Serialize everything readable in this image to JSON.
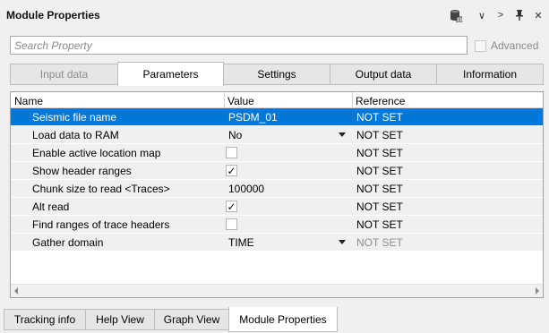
{
  "panel": {
    "title": "Module Properties",
    "toolbar": {
      "icons": [
        "database-icon",
        "chevron-down-icon",
        "chevron-right-icon",
        "pin-icon",
        "close-icon"
      ],
      "chevron_down": "∨",
      "chevron_right": ">",
      "close": "✕"
    }
  },
  "search": {
    "placeholder": "Search Property",
    "value": "",
    "advanced_label": "Advanced",
    "advanced_checked": false
  },
  "tabs": [
    {
      "label": "Input data",
      "state": "disabled"
    },
    {
      "label": "Parameters",
      "state": "active"
    },
    {
      "label": "Settings",
      "state": "normal"
    },
    {
      "label": "Output data",
      "state": "normal"
    },
    {
      "label": "Information",
      "state": "normal"
    }
  ],
  "grid": {
    "columns": [
      "Name",
      "Value",
      "Reference"
    ],
    "rows": [
      {
        "name": "Seismic file name",
        "value": "PSDM_01",
        "type": "text",
        "reference": "NOT SET",
        "selected": true
      },
      {
        "name": "Load data to RAM",
        "value": "No",
        "type": "dropdown",
        "reference": "NOT SET"
      },
      {
        "name": "Enable active location map",
        "value": "",
        "type": "checkbox",
        "checked": false,
        "reference": "NOT SET"
      },
      {
        "name": "Show header ranges",
        "value": "",
        "type": "checkbox",
        "checked": true,
        "reference": "NOT SET"
      },
      {
        "name": "Chunk size to read <Traces>",
        "value": "100000",
        "type": "text",
        "reference": "NOT SET"
      },
      {
        "name": "Alt read",
        "value": "",
        "type": "checkbox",
        "checked": true,
        "reference": "NOT SET"
      },
      {
        "name": "Find ranges of trace headers",
        "value": "",
        "type": "checkbox",
        "checked": false,
        "reference": "NOT SET"
      },
      {
        "name": "Gather domain",
        "value": "TIME",
        "type": "dropdown",
        "reference": "NOT SET",
        "reference_muted": true
      }
    ]
  },
  "bottom_tabs": [
    {
      "label": "Tracking info",
      "active": false
    },
    {
      "label": "Help View",
      "active": false
    },
    {
      "label": "Graph View",
      "active": false
    },
    {
      "label": "Module Properties",
      "active": true
    }
  ],
  "colors": {
    "selection": "#0078d7",
    "row_background": "#f0f0f0",
    "muted_text": "#8d8d8d"
  }
}
